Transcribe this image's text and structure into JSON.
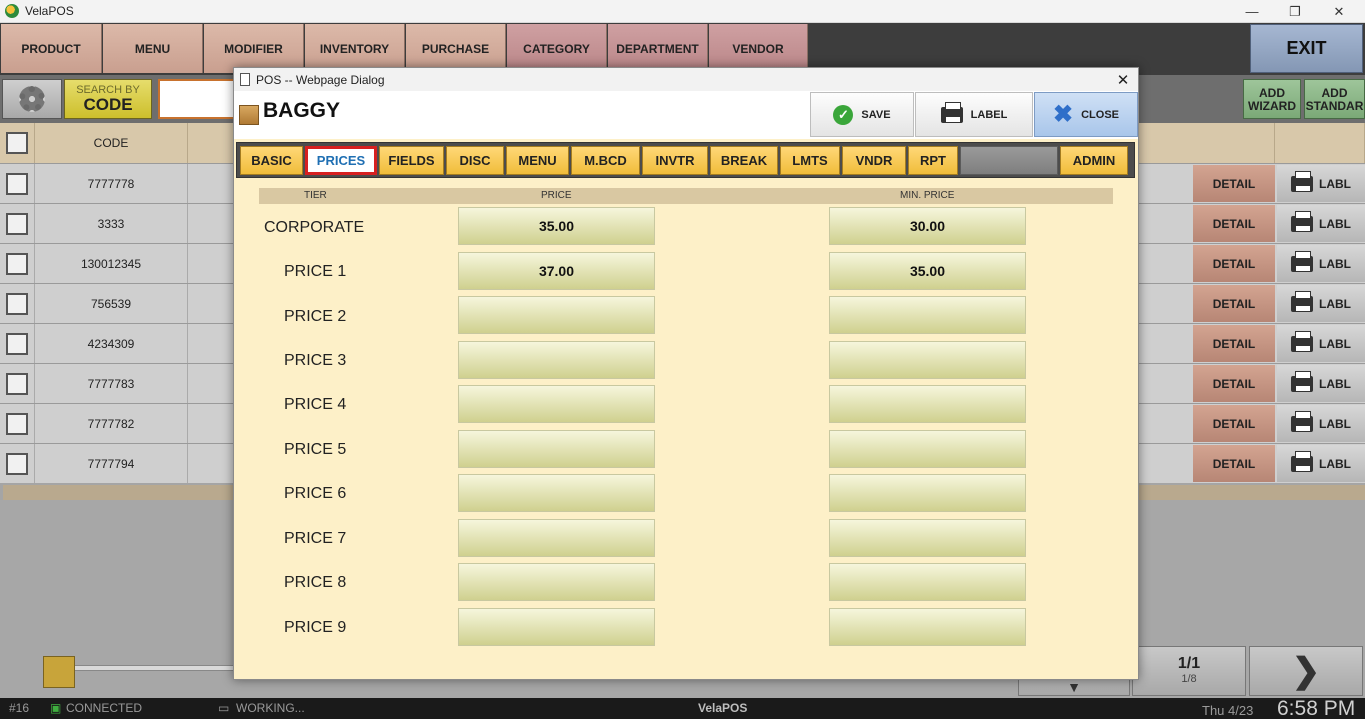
{
  "window": {
    "title": "VelaPOS"
  },
  "nav": {
    "items": [
      "PRODUCT",
      "MENU",
      "MODIFIER",
      "INVENTORY",
      "PURCHASE",
      "CATEGORY",
      "DEPARTMENT",
      "VENDOR"
    ],
    "exit": "EXIT"
  },
  "toolbar": {
    "search_by": "SEARCH BY",
    "search_mode": "CODE",
    "add_wizard": "ADD WIZARD",
    "add_standard": "ADD STANDAR"
  },
  "table": {
    "header_code": "CODE",
    "rows": [
      {
        "code": "7777778"
      },
      {
        "code": "3333"
      },
      {
        "code": "130012345"
      },
      {
        "code": "756539"
      },
      {
        "code": "4234309"
      },
      {
        "code": "7777783"
      },
      {
        "code": "7777782"
      },
      {
        "code": "7777794"
      }
    ],
    "detail_label": "DETAIL",
    "labl_label": "LABL"
  },
  "pager": {
    "page": "1/1",
    "sub": "1/8"
  },
  "status": {
    "id": "#16",
    "connected": "CONNECTED",
    "working": "WORKING...",
    "app": "VelaPOS",
    "date": "Thu 4/23",
    "time": "6:58 PM"
  },
  "dialog": {
    "title": "POS -- Webpage Dialog",
    "item_name": "BAGGY",
    "save": "SAVE",
    "label": "LABEL",
    "close": "CLOSE",
    "tabs": [
      "BASIC",
      "PRICES",
      "FIELDS",
      "DISC",
      "MENU",
      "M.BCD",
      "INVTR",
      "BREAK",
      "LMTS",
      "VNDR",
      "RPT"
    ],
    "admin": "ADMIN",
    "active_tab": "PRICES",
    "col_tier": "TIER",
    "col_price": "PRICE",
    "col_min_price": "MIN. PRICE",
    "tiers": [
      {
        "name": "CORPORATE",
        "price": "35.00",
        "min": "30.00"
      },
      {
        "name": "PRICE 1",
        "price": "37.00",
        "min": "35.00"
      },
      {
        "name": "PRICE 2",
        "price": "",
        "min": ""
      },
      {
        "name": "PRICE 3",
        "price": "",
        "min": ""
      },
      {
        "name": "PRICE 4",
        "price": "",
        "min": ""
      },
      {
        "name": "PRICE 5",
        "price": "",
        "min": ""
      },
      {
        "name": "PRICE 6",
        "price": "",
        "min": ""
      },
      {
        "name": "PRICE 7",
        "price": "",
        "min": ""
      },
      {
        "name": "PRICE 8",
        "price": "",
        "min": ""
      },
      {
        "name": "PRICE 9",
        "price": "",
        "min": ""
      }
    ]
  }
}
